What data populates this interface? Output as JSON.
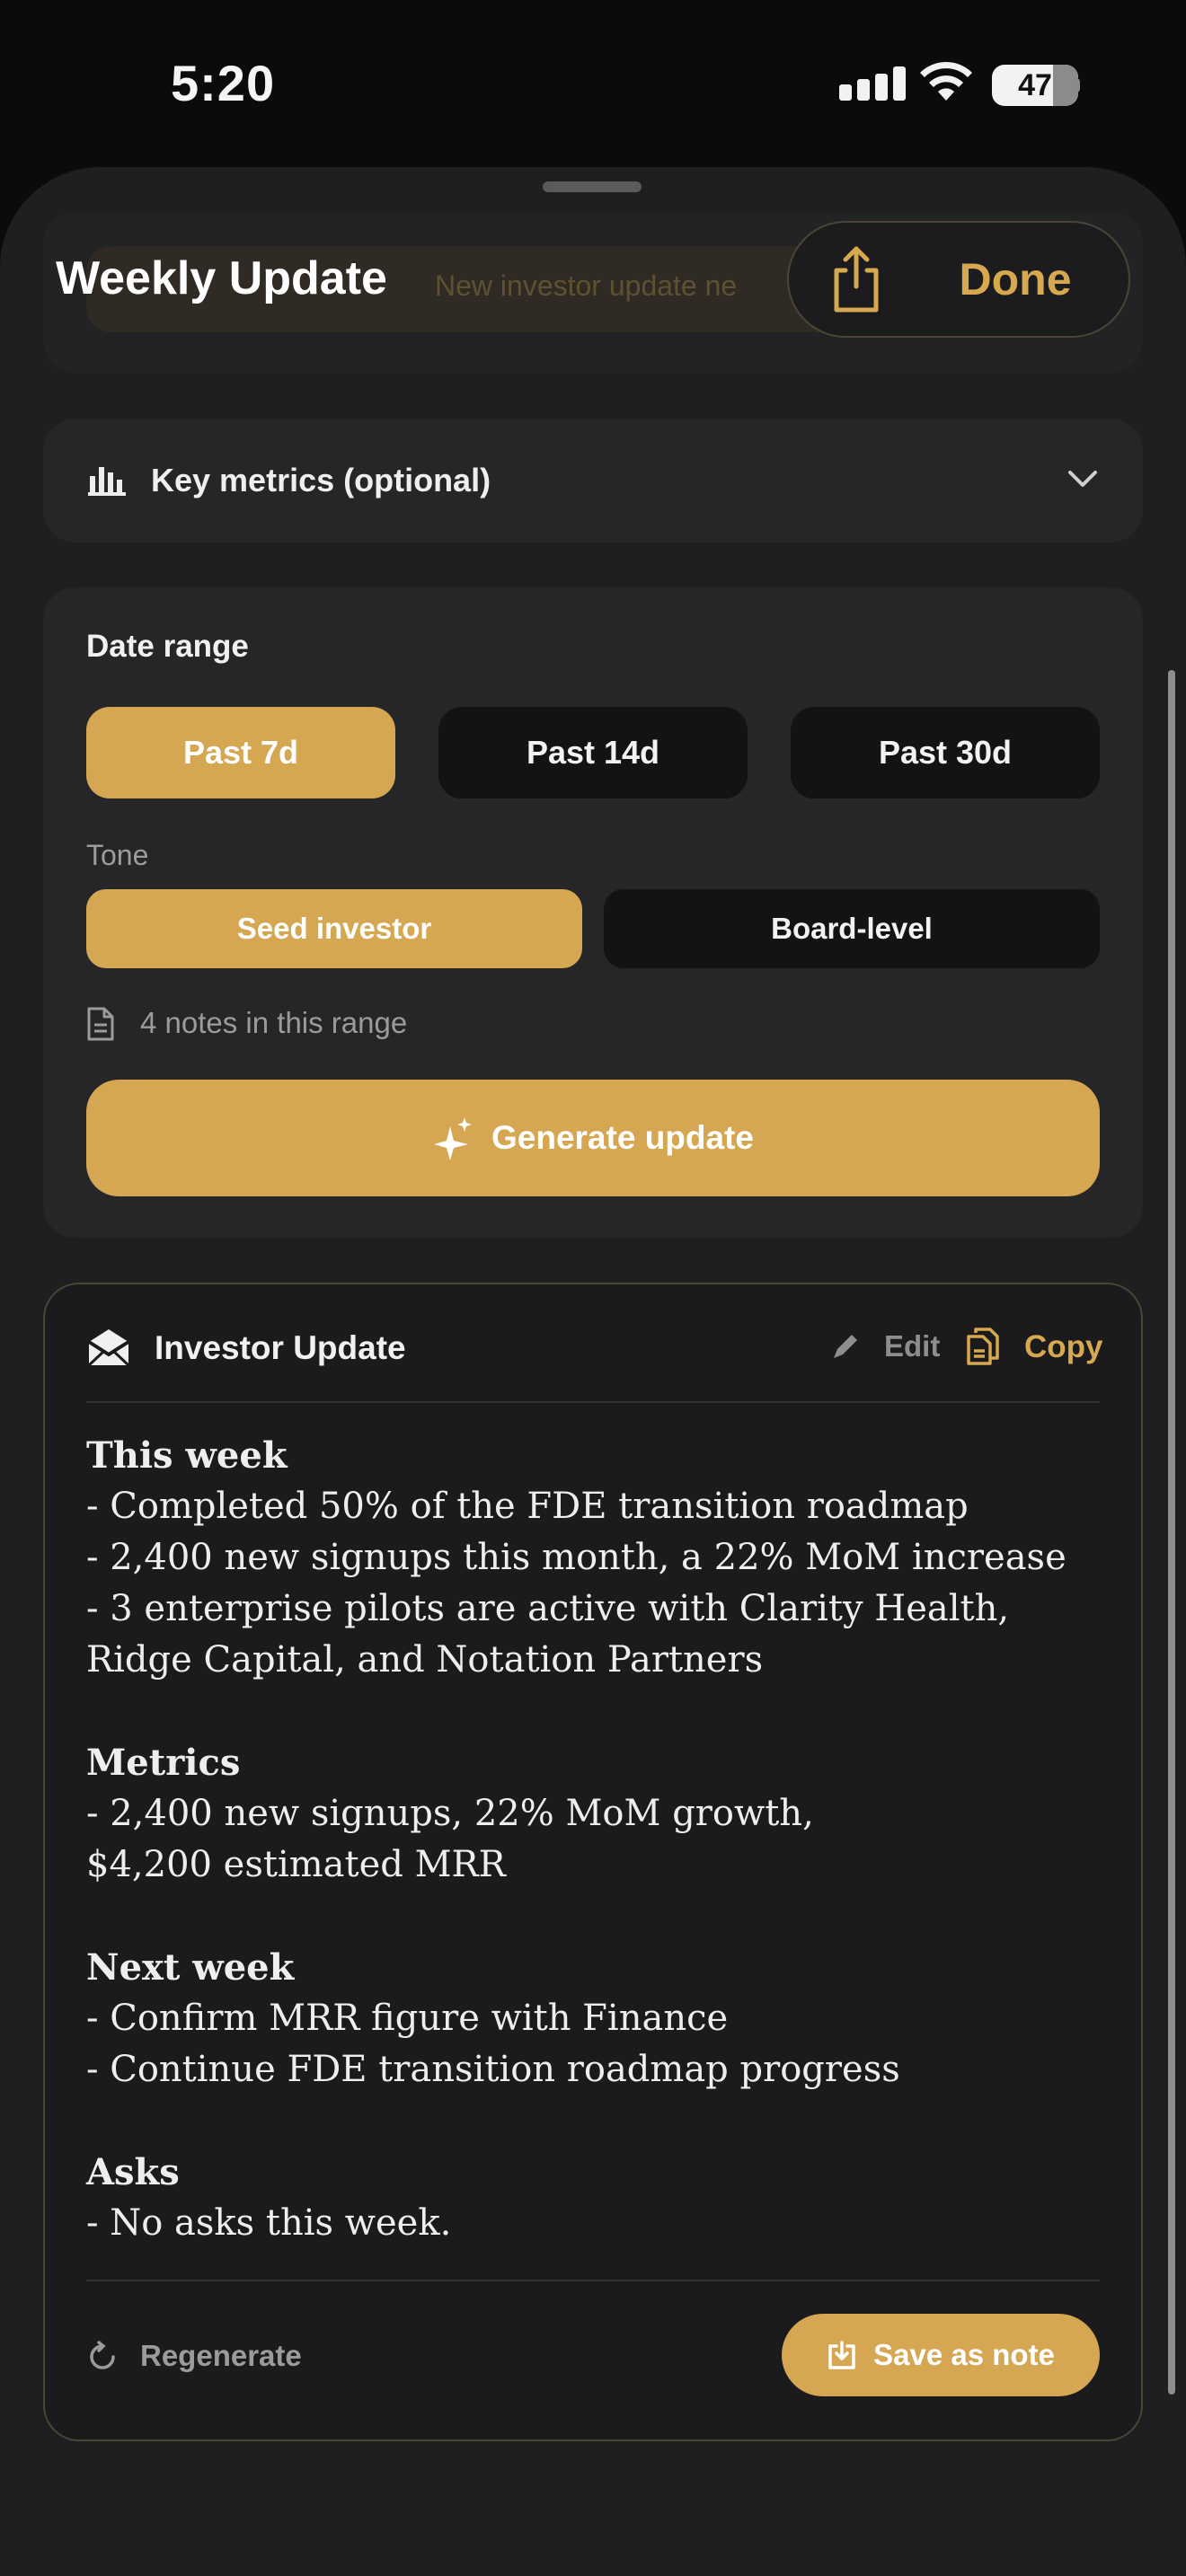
{
  "status_bar": {
    "time": "5:20",
    "battery": "47"
  },
  "sheet": {
    "title": "Weekly Update",
    "done_label": "Done",
    "background_hint": "New investor update ne"
  },
  "metrics": {
    "label": "Key metrics (optional)"
  },
  "date_range": {
    "label": "Date range",
    "options": [
      "Past 7d",
      "Past 14d",
      "Past 30d"
    ],
    "selected": "Past 7d"
  },
  "tone": {
    "label": "Tone",
    "options": [
      "Seed investor",
      "Board-level"
    ],
    "selected": "Seed investor"
  },
  "notes_count": "4 notes in this range",
  "generate_label": "Generate update",
  "update": {
    "title": "Investor Update",
    "edit_label": "Edit",
    "copy_label": "Copy",
    "sections": [
      {
        "heading": "This week",
        "lines": [
          "- Completed 50% of the FDE transition roadmap",
          "- 2,400 new signups this month, a 22% MoM increase",
          "- 3 enterprise pilots are active with Clarity Health, Ridge Capital, and Notation Partners"
        ]
      },
      {
        "heading": "Metrics",
        "lines": [
          "- 2,400 new signups, 22% MoM growth, $4,200 estimated MRR"
        ]
      },
      {
        "heading": "Next week",
        "lines": [
          "- Confirm MRR figure with Finance",
          "- Continue FDE transition roadmap progress"
        ]
      },
      {
        "heading": "Asks",
        "lines": [
          "- No asks this week."
        ]
      }
    ],
    "regenerate_label": "Regenerate",
    "save_label": "Save as note"
  },
  "colors": {
    "accent": "#d6a752",
    "sheet": "#1f1f21",
    "card": "#262628"
  }
}
